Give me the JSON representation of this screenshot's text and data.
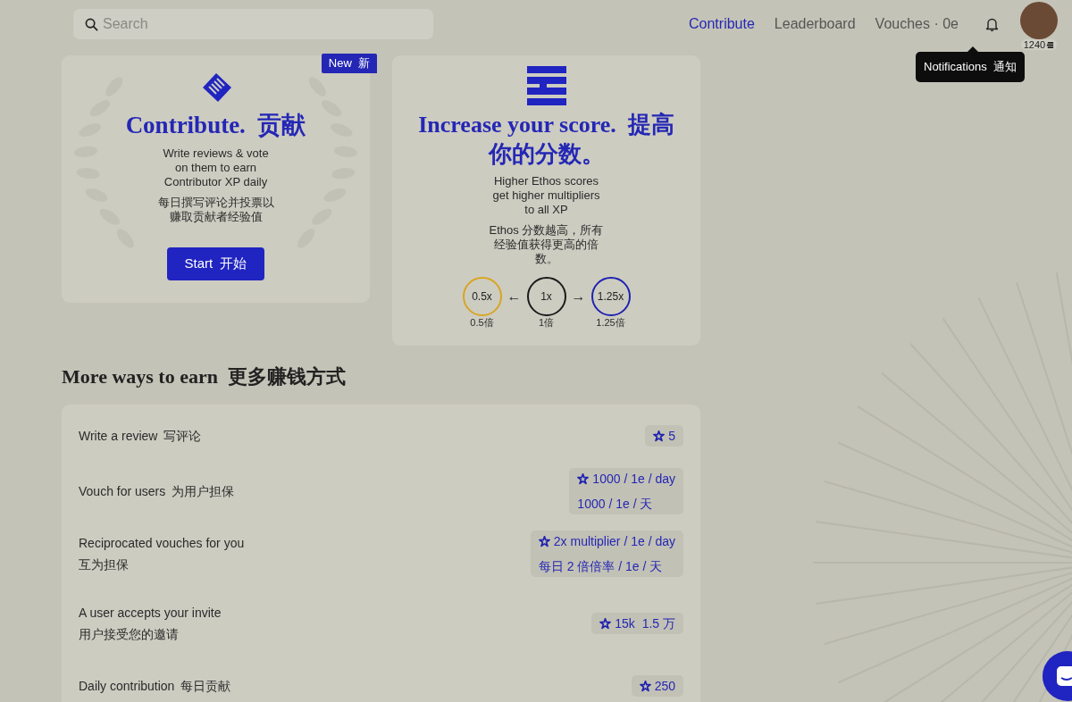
{
  "search": {
    "placeholder": "Search"
  },
  "nav": [
    {
      "label": "Contribute",
      "selected": true
    },
    {
      "label": "Leaderboard",
      "selected": false
    },
    {
      "label": "Vouches · 0e",
      "selected": false
    }
  ],
  "profile": {
    "score": "1240"
  },
  "tooltip": "Notifications  通知",
  "contribute_card": {
    "badge": "New  新",
    "title": "Contribute.  贡献",
    "description": "Write reviews & vote on them to earn Contributor XP daily",
    "description_cn": "每日撰写评论并投票以赚取贡献者经验值",
    "button": "Start  开始"
  },
  "score_card": {
    "title": "Increase your score.  提高你的分数。",
    "description": "Higher Ethos scores get higher multipliers to all XP",
    "description_cn": "Ethos 分数越高，所有经验值获得更高的倍数。",
    "multipliers": [
      {
        "label": "0.5x",
        "label_cn": "0.5倍",
        "color": "#d9a521"
      },
      {
        "arrow": "←"
      },
      {
        "label": "1x",
        "label_cn": "1倍",
        "color": "#1a1a1a"
      },
      {
        "arrow": "→"
      },
      {
        "label": "1.25x",
        "label_cn": "1.25倍",
        "color": "#1f22b0"
      }
    ]
  },
  "more_ways": {
    "title": "More ways to earn  更多赚钱方式",
    "rows": [
      {
        "kind": "inline",
        "title": "Write a review",
        "title_cn": "写评论",
        "reward": [
          "5"
        ]
      },
      {
        "kind": "inline",
        "title": "Vouch for users",
        "title_cn": "为用户担保",
        "reward": [
          "1000 / 1e / day",
          "1000 / 1e / 天"
        ]
      },
      {
        "kind": "stacked",
        "title": "Reciprocated vouches for you",
        "title_cn": "互为担保",
        "reward": [
          "2x multiplier / 1e / day",
          "每日 2 倍倍率 / 1e / 天"
        ]
      },
      {
        "kind": "stacked",
        "title": "A user accepts your invite",
        "title_cn": "用户接受您的邀请",
        "reward": [
          "15k  1.5 万"
        ]
      },
      {
        "kind": "inline",
        "title": "Daily contribution",
        "title_cn": "每日贡献",
        "reward": [
          "250"
        ]
      }
    ]
  }
}
